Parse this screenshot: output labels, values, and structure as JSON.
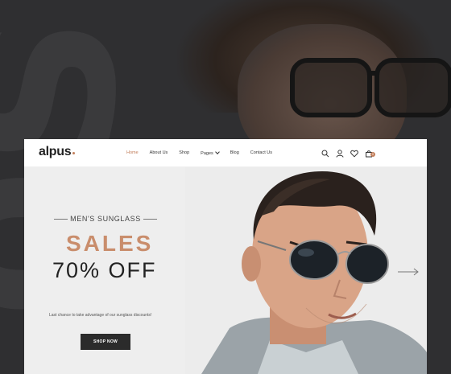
{
  "site": {
    "logo": "alpus"
  },
  "nav": {
    "items": [
      {
        "label": "Home",
        "active": true
      },
      {
        "label": "About Us"
      },
      {
        "label": "Shop"
      },
      {
        "label": "Pages",
        "has_dropdown": true
      },
      {
        "label": "Blog"
      },
      {
        "label": "Contact Us"
      }
    ],
    "icons": [
      "search-icon",
      "user-icon",
      "heart-icon",
      "cart-icon"
    ],
    "cart_count": "0"
  },
  "hero": {
    "subtitle": "MEN'S SUNGLASS",
    "headline": "SALES",
    "offer": "70% OFF",
    "tagline": "Last chance to take advantage of our sunglass discounts!",
    "cta": "SHOP NOW"
  },
  "colors": {
    "accent": "#c27e5b",
    "headline": "#c98d6c",
    "button": "#2b2b2b",
    "backdrop": "#2f2f31"
  }
}
